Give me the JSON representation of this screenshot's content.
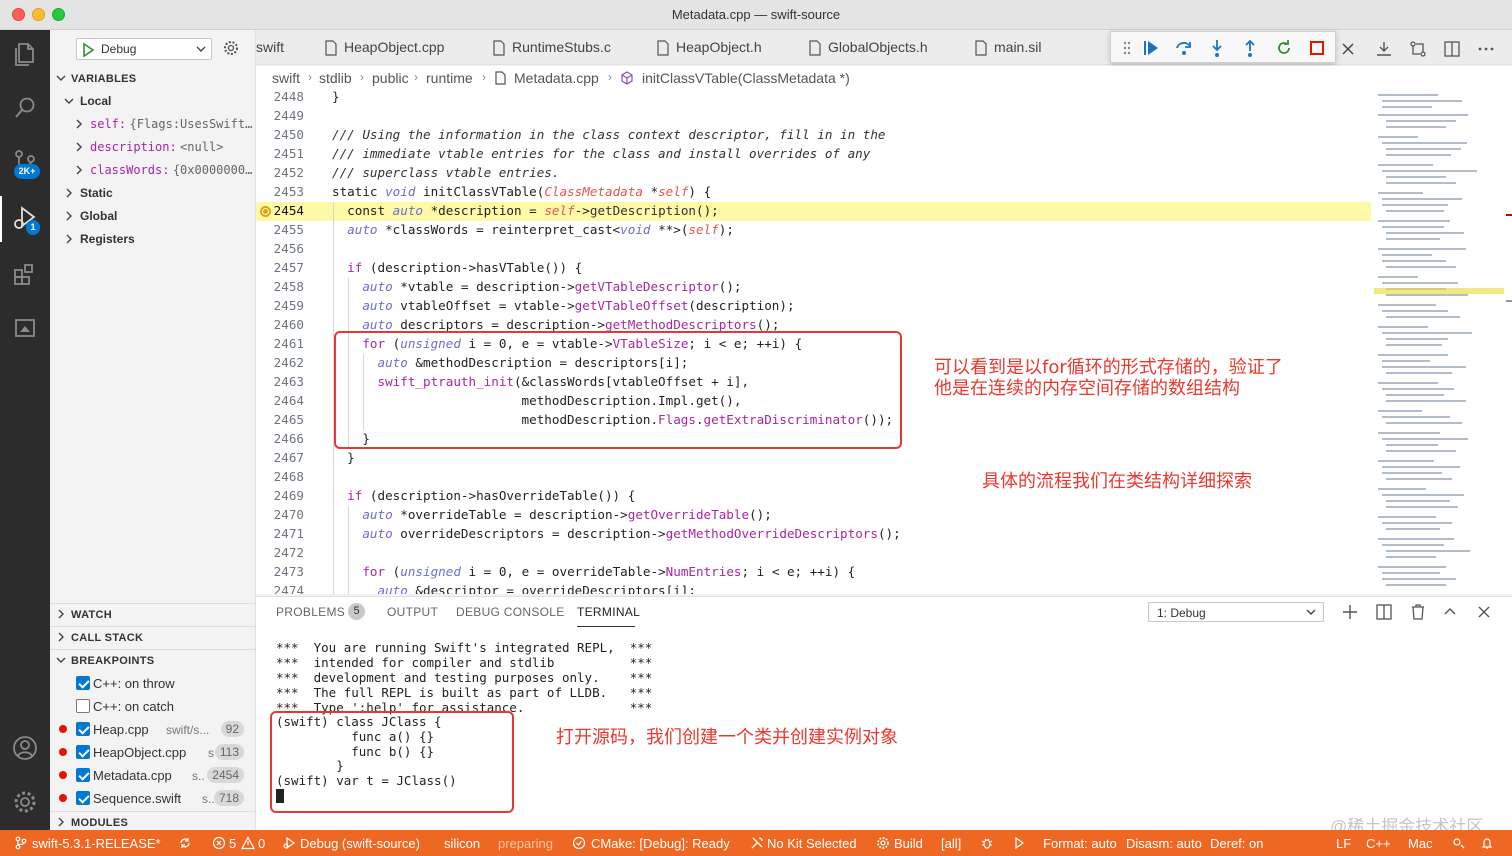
{
  "window": {
    "title": "Metadata.cpp — swift-source"
  },
  "activity": {
    "scm_badge": "2K+",
    "debug_badge": "1"
  },
  "sidebar": {
    "debug_config": "Debug",
    "variables_title": "VARIABLES",
    "local_label": "Local",
    "locals": [
      {
        "name": "self:",
        "value": "{Flags:UsesSwift…"
      },
      {
        "name": "description:",
        "value": "<null>"
      },
      {
        "name": "classWords:",
        "value": "{0x0000000…"
      }
    ],
    "scopes": [
      "Static",
      "Global",
      "Registers"
    ],
    "watch_title": "WATCH",
    "call_stack_title": "CALL STACK",
    "breakpoints_title": "BREAKPOINTS",
    "exception_breakpoints": [
      {
        "label": "C++: on throw",
        "checked": true
      },
      {
        "label": "C++: on catch",
        "checked": false
      }
    ],
    "breakpoints": [
      {
        "file": "Heap.cpp",
        "path": "swift/s...",
        "line": "92"
      },
      {
        "file": "HeapObject.cpp",
        "path": "s",
        "line": "113"
      },
      {
        "file": "Metadata.cpp",
        "path": "s..",
        "line": "2454"
      },
      {
        "file": "Sequence.swift",
        "path": "s..",
        "line": "718"
      }
    ],
    "modules_title": "MODULES"
  },
  "tabs": [
    "swift",
    "HeapObject.cpp",
    "RuntimeStubs.c",
    "HeapObject.h",
    "GlobalObjects.h",
    "main.sil"
  ],
  "breadcrumbs": [
    "swift",
    "stdlib",
    "public",
    "runtime",
    "Metadata.cpp",
    "initClassVTable(ClassMetadata *)"
  ],
  "editor": {
    "line_numbers": [
      "2448",
      "2449",
      "2450",
      "2451",
      "2452",
      "2453",
      "2454",
      "2455",
      "2456",
      "2457",
      "2458",
      "2459",
      "2460",
      "2461",
      "2462",
      "2463",
      "2464",
      "2465",
      "2466",
      "2467",
      "2468",
      "2469",
      "2470",
      "2471",
      "2472",
      "2473",
      "2474"
    ],
    "current_line": "2454"
  },
  "annotations": {
    "for_loop_note_1": "可以看到是以for循环的形式存储的，验证了",
    "for_loop_note_2": "他是在连续的内存空间存储的数组结构",
    "flow_note": "具体的流程我们在类结构详细探索",
    "terminal_note": "打开源码，我们创建一个类并创建实例对象"
  },
  "panel": {
    "tabs": [
      "PROBLEMS",
      "OUTPUT",
      "DEBUG CONSOLE",
      "TERMINAL"
    ],
    "problems_count": "5",
    "active_tab": "TERMINAL",
    "terminal_select": "1: Debug",
    "terminal_lines": [
      "***  You are running Swift's integrated REPL,  ***",
      "***  intended for compiler and stdlib          ***",
      "***  development and testing purposes only.    ***",
      "***  The full REPL is built as part of LLDB.   ***",
      "***  Type ':help' for assistance.              ***",
      "(swift) class JClass {",
      "          func a() {}",
      "          func b() {}",
      "        }",
      "(swift) var t = JClass()"
    ]
  },
  "statusbar": {
    "branch": "swift-5.3.1-RELEASE*",
    "errors": "5",
    "warnings": "0",
    "debug": "Debug (swift-source)",
    "silicon": "silicon",
    "preparing": "preparing",
    "cmake": "CMake: [Debug]: Ready",
    "kit": "No Kit Selected",
    "build": "Build",
    "all": "[all]",
    "format": "Format: auto",
    "disasm": "Disasm: auto",
    "deref": "Deref: on",
    "eol": "LF",
    "lang": "C++",
    "platform": "Mac"
  },
  "watermark": "@稀土掘金技术社区",
  "colors": {
    "statusbar": "#ee6723",
    "annotation": "#e8382f",
    "current_line": "#fdf9a6",
    "activity": "#2c2c2c"
  }
}
